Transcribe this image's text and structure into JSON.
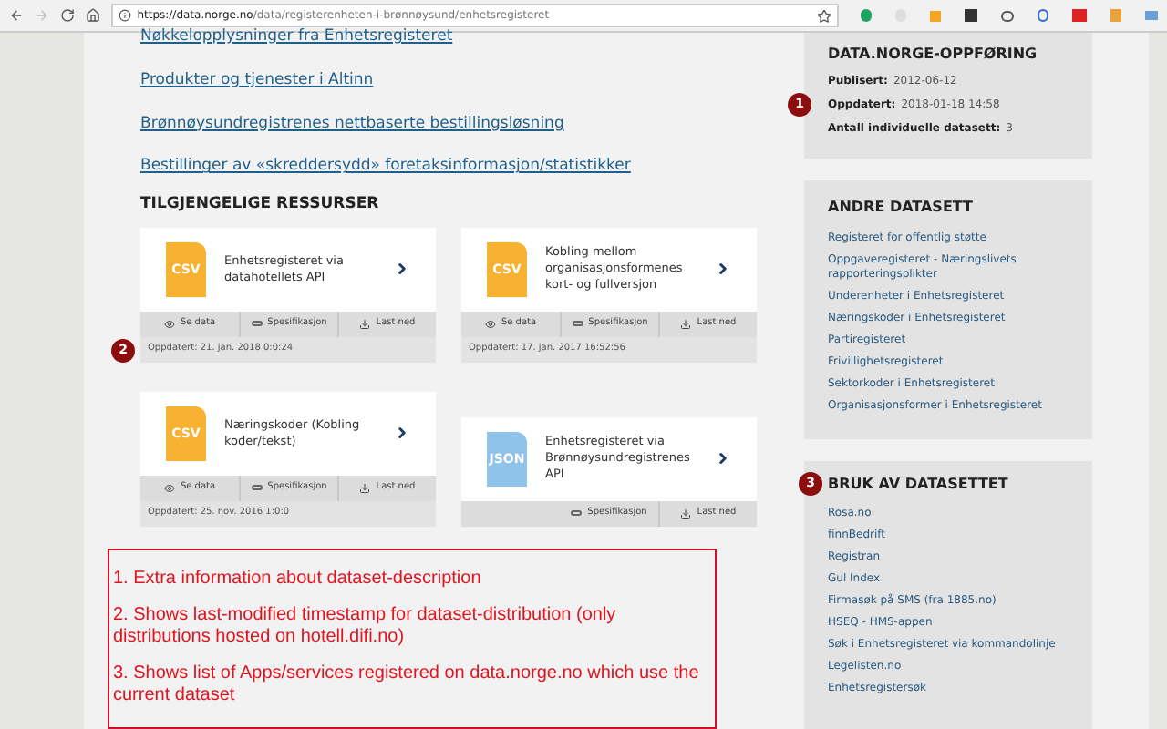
{
  "browser": {
    "url_host": "https://data.norge.no",
    "url_path": "/data/registerenheten-i-brønnøysund/enhetsregisteret"
  },
  "links": [
    "Nøkkelopplysninger fra Enhetsregisteret",
    "Produkter og tjenester i Altinn",
    "Brønnøysundregistrenes nettbaserte bestillingsløsning",
    "Bestillinger av «skreddersydd» foretaksinformasjon/statistikker"
  ],
  "resources": {
    "heading": "TILGJENGELIGE RESSURSER",
    "cards": [
      {
        "format": "CSV",
        "kind": "csv",
        "title": "Enhetsregisteret via datahotellets API",
        "actions": [
          "Se data",
          "Spesifikasjon",
          "Last ned"
        ],
        "updated": "Oppdatert: 21. jan. 2018 0:0:24",
        "badge": "2"
      },
      {
        "format": "CSV",
        "kind": "csv",
        "title": "Kobling mellom organisasjonsformenes kort- og fullversjon",
        "actions": [
          "Se data",
          "Spesifikasjon",
          "Last ned"
        ],
        "updated": "Oppdatert: 17. jan. 2017 16:52:56"
      },
      {
        "format": "CSV",
        "kind": "csv",
        "title": "Næringskoder (Kobling koder/tekst)",
        "actions": [
          "Se data",
          "Spesifikasjon",
          "Last ned"
        ],
        "updated": "Oppdatert: 25. nov. 2016 1:0:0"
      },
      {
        "format": "JSON",
        "kind": "json",
        "title": "Enhetsregisteret via Brønnøysundregistrenes API",
        "actions": [
          "Spesifikasjon",
          "Last ned"
        ]
      }
    ]
  },
  "notes": [
    "1. Extra information about dataset-description",
    "2. Shows last-modified timestamp for dataset-distribution (only distributions hosted on hotell.difi.no)",
    "3. Shows list of Apps/services registered on data.norge.no which use the current dataset"
  ],
  "listing": {
    "title": "DATA.NORGE-OPPFØRING",
    "fields": [
      {
        "label": "Publisert:",
        "value": "2012-06-12"
      },
      {
        "label": "Oppdatert:",
        "value": "2018-01-18 14:58",
        "badge": "1"
      },
      {
        "label": "Antall individuelle datasett:",
        "value": "3"
      }
    ]
  },
  "other_datasets": {
    "title": "ANDRE DATASETT",
    "items": [
      "Registeret for offentlig støtte",
      "Oppgaveregisteret - Næringslivets rapporteringsplikter",
      "Underenheter i Enhetsregisteret",
      "Næringskoder i Enhetsregisteret",
      "Partiregisteret",
      "Frivillighetsregisteret",
      "Sektorkoder i Enhetsregisteret",
      "Organisasjonsformer i Enhetsregisteret"
    ]
  },
  "usage": {
    "title": "BRUK AV DATASETTET",
    "badge": "3",
    "items": [
      "Rosa.no",
      "finnBedrift",
      "Registran",
      "Gul Index",
      "Firmasøk på SMS (fra 1885.no)",
      "HSEQ - HMS-appen",
      "Søk i Enhetsregisteret via kommandolinje",
      "Legelisten.no",
      "Enhetsregistersøk"
    ]
  }
}
